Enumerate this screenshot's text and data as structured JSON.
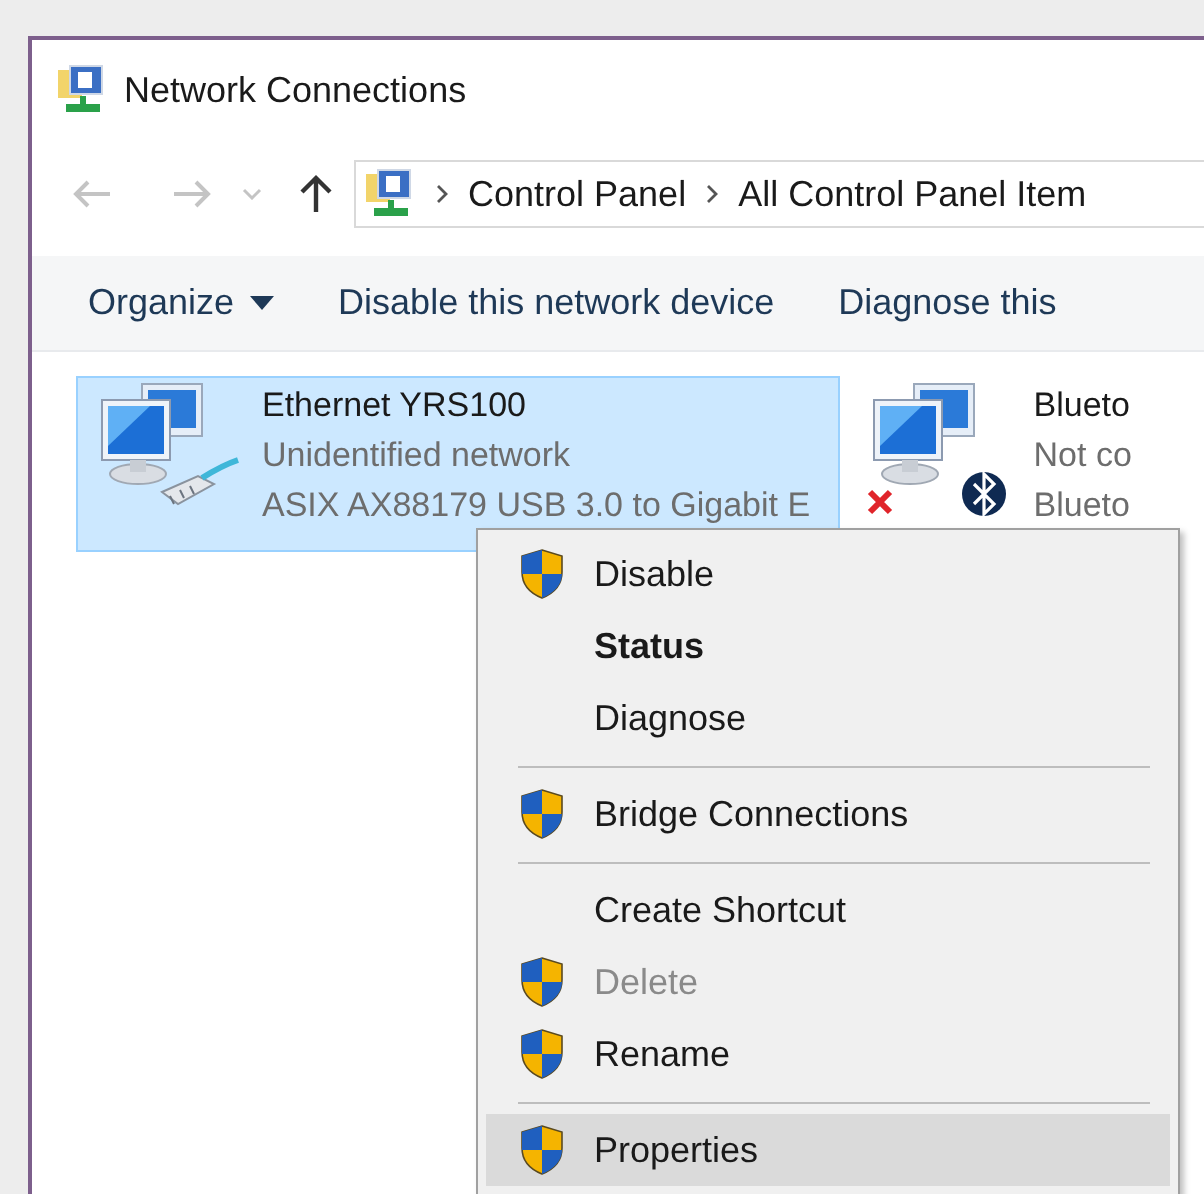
{
  "window": {
    "title": "Network Connections"
  },
  "address_bar": {
    "crumbs": [
      "Control Panel",
      "All Control Panel Item"
    ]
  },
  "toolbar": [
    {
      "label": "Organize",
      "dropdown": true
    },
    {
      "label": "Disable this network device",
      "dropdown": false
    },
    {
      "label": "Diagnose this",
      "dropdown": false
    }
  ],
  "connections": [
    {
      "name": "Ethernet YRS100",
      "status": "Unidentified network",
      "device": "ASIX AX88179 USB 3.0 to Gigabit E",
      "kind": "ethernet",
      "selected": true
    },
    {
      "name": "Blueto",
      "status": "Not co",
      "device": "Blueto",
      "kind": "bluetooth",
      "selected": false
    }
  ],
  "context_menu": [
    {
      "kind": "item",
      "label": "Disable",
      "shield": true,
      "bold": false,
      "disabled": false,
      "selected": false
    },
    {
      "kind": "item",
      "label": "Status",
      "shield": false,
      "bold": true,
      "disabled": false,
      "selected": false
    },
    {
      "kind": "item",
      "label": "Diagnose",
      "shield": false,
      "bold": false,
      "disabled": false,
      "selected": false
    },
    {
      "kind": "separator"
    },
    {
      "kind": "item",
      "label": "Bridge Connections",
      "shield": true,
      "bold": false,
      "disabled": false,
      "selected": false
    },
    {
      "kind": "separator"
    },
    {
      "kind": "item",
      "label": "Create Shortcut",
      "shield": false,
      "bold": false,
      "disabled": false,
      "selected": false
    },
    {
      "kind": "item",
      "label": "Delete",
      "shield": true,
      "bold": false,
      "disabled": true,
      "selected": false
    },
    {
      "kind": "item",
      "label": "Rename",
      "shield": true,
      "bold": false,
      "disabled": false,
      "selected": false
    },
    {
      "kind": "separator"
    },
    {
      "kind": "item",
      "label": "Properties",
      "shield": true,
      "bold": false,
      "disabled": false,
      "selected": true
    }
  ]
}
